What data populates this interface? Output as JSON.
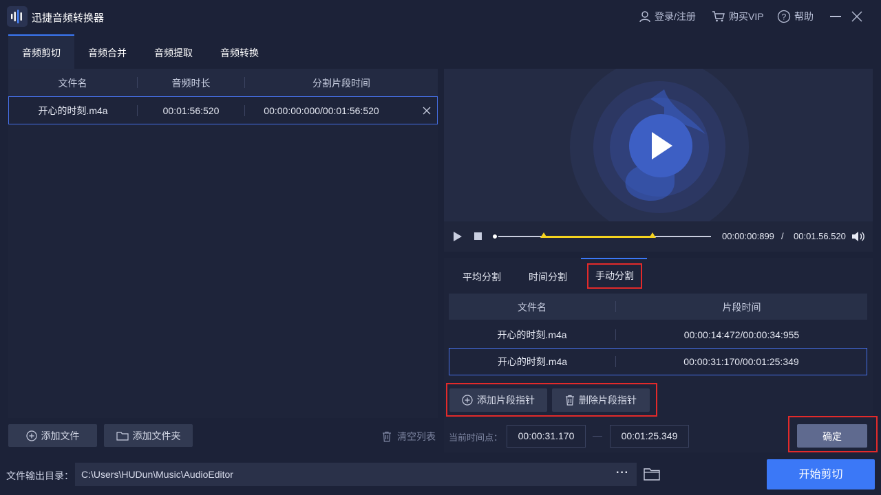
{
  "app": {
    "title": "迅捷音频转换器",
    "login": "登录/注册",
    "buy_vip": "购买VIP",
    "help": "帮助"
  },
  "tabs": [
    {
      "label": "音频剪切",
      "active": true
    },
    {
      "label": "音频合并",
      "active": false
    },
    {
      "label": "音频提取",
      "active": false
    },
    {
      "label": "音频转换",
      "active": false
    }
  ],
  "file_table": {
    "headers": [
      "文件名",
      "音频时长",
      "分割片段时间"
    ],
    "rows": [
      {
        "name": "开心的时刻.m4a",
        "duration": "00:01:56:520",
        "segment": "00:00:00:000/00:01:56:520"
      }
    ]
  },
  "left_actions": {
    "add_file": "添加文件",
    "add_folder": "添加文件夹",
    "clear_list": "清空列表"
  },
  "player": {
    "current_time": "00:00:00:899",
    "separator": "/",
    "total_time": "00:01.56.520",
    "progress": 0.0,
    "markers": [
      0.23,
      0.73
    ]
  },
  "split_tabs": [
    {
      "label": "平均分割",
      "active": false
    },
    {
      "label": "时间分割",
      "active": false
    },
    {
      "label": "手动分割",
      "active": true
    }
  ],
  "segment_table": {
    "headers": [
      "文件名",
      "片段时间"
    ],
    "rows": [
      {
        "name": "开心的时刻.m4a",
        "time": "00:00:14:472/00:00:34:955",
        "selected": false
      },
      {
        "name": "开心的时刻.m4a",
        "time": "00:00:31:170/00:01:25:349",
        "selected": true
      }
    ]
  },
  "segment_actions": {
    "add_pointer": "添加片段指针",
    "delete_pointer": "删除片段指针"
  },
  "current_point": {
    "label": "当前时间点：",
    "start": "00:00:31.170",
    "end": "00:01:25.349"
  },
  "confirm": "确定",
  "output": {
    "label": "文件输出目录：",
    "path": "C:\\Users\\HUDun\\Music\\AudioEditor",
    "more": "···"
  },
  "start_button": "开始剪切",
  "colors": {
    "accent": "#3b78f7",
    "highlight_box": "#e32a2a",
    "segment_line": "#f5d31f"
  }
}
